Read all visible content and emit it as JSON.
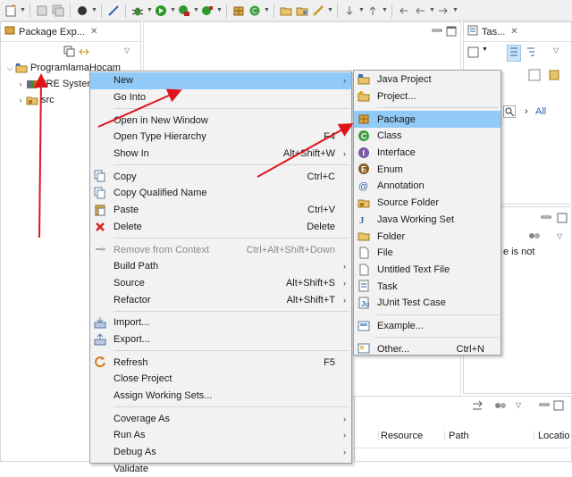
{
  "toolbar": {
    "icons": [
      "new-icon",
      "save-icon",
      "save-all-icon",
      "debug-skip-icon",
      "breakpoint-icon",
      "debug-icon",
      "run-icon",
      "coverage-icon",
      "external-tools-icon",
      "new-java-package-icon",
      "new-class-icon",
      "open-type-icon",
      "search-icon",
      "annotation-icon",
      "next-annotation-icon",
      "back-icon",
      "forward-icon"
    ]
  },
  "explorer": {
    "tab_title": "Package Exp...",
    "close": "✕",
    "tree": [
      {
        "label": "ProgramlamaHocam",
        "expanded": true
      },
      {
        "label": "JRE System",
        "expanded": false
      },
      {
        "label": "src",
        "expanded": false
      }
    ]
  },
  "task_view": {
    "tab_title": "Tas...",
    "find_placeholder": "",
    "all_label": "All",
    "outline_text": "e is not"
  },
  "problems_view": {
    "columns": [
      "Resource",
      "Path",
      "Locatio"
    ]
  },
  "context_menu": {
    "items": [
      {
        "label": "New",
        "shortcut": "",
        "sub": true,
        "icon": "",
        "highlighted": true
      },
      {
        "label": "Go Into",
        "shortcut": "",
        "sub": false,
        "icon": ""
      },
      {
        "sep": true
      },
      {
        "label": "Open in New Window",
        "shortcut": "",
        "sub": false,
        "icon": ""
      },
      {
        "label": "Open Type Hierarchy",
        "shortcut": "F4",
        "sub": false,
        "icon": ""
      },
      {
        "label": "Show In",
        "shortcut": "Alt+Shift+W",
        "sub": true,
        "icon": ""
      },
      {
        "sep": true
      },
      {
        "label": "Copy",
        "shortcut": "Ctrl+C",
        "sub": false,
        "icon": "copy-icon"
      },
      {
        "label": "Copy Qualified Name",
        "shortcut": "",
        "sub": false,
        "icon": "copy-icon"
      },
      {
        "label": "Paste",
        "shortcut": "Ctrl+V",
        "sub": false,
        "icon": "paste-icon"
      },
      {
        "label": "Delete",
        "shortcut": "Delete",
        "sub": false,
        "icon": "delete-icon"
      },
      {
        "sep": true
      },
      {
        "label": "Remove from Context",
        "shortcut": "Ctrl+Alt+Shift+Down",
        "sub": false,
        "icon": "remove-context-icon",
        "disabled": true
      },
      {
        "label": "Build Path",
        "shortcut": "",
        "sub": true,
        "icon": ""
      },
      {
        "label": "Source",
        "shortcut": "Alt+Shift+S",
        "sub": true,
        "icon": ""
      },
      {
        "label": "Refactor",
        "shortcut": "Alt+Shift+T",
        "sub": true,
        "icon": ""
      },
      {
        "sep": true
      },
      {
        "label": "Import...",
        "shortcut": "",
        "sub": false,
        "icon": "import-icon"
      },
      {
        "label": "Export...",
        "shortcut": "",
        "sub": false,
        "icon": "export-icon"
      },
      {
        "sep": true
      },
      {
        "label": "Refresh",
        "shortcut": "F5",
        "sub": false,
        "icon": "refresh-icon"
      },
      {
        "label": "Close Project",
        "shortcut": "",
        "sub": false,
        "icon": ""
      },
      {
        "label": "Assign Working Sets...",
        "shortcut": "",
        "sub": false,
        "icon": ""
      },
      {
        "sep": true
      },
      {
        "label": "Coverage As",
        "shortcut": "",
        "sub": true,
        "icon": ""
      },
      {
        "label": "Run As",
        "shortcut": "",
        "sub": true,
        "icon": ""
      },
      {
        "label": "Debug As",
        "shortcut": "",
        "sub": true,
        "icon": ""
      },
      {
        "label": "Validate",
        "shortcut": "",
        "sub": false,
        "icon": ""
      }
    ]
  },
  "submenu": {
    "items": [
      {
        "label": "Java Project",
        "shortcut": "",
        "icon": "java-project-icon"
      },
      {
        "label": "Project...",
        "shortcut": "",
        "icon": "project-icon"
      },
      {
        "sep": true
      },
      {
        "label": "Package",
        "shortcut": "",
        "icon": "package-icon",
        "highlighted": true
      },
      {
        "label": "Class",
        "shortcut": "",
        "icon": "class-icon"
      },
      {
        "label": "Interface",
        "shortcut": "",
        "icon": "interface-icon"
      },
      {
        "label": "Enum",
        "shortcut": "",
        "icon": "enum-icon"
      },
      {
        "label": "Annotation",
        "shortcut": "",
        "icon": "annotation-type-icon"
      },
      {
        "label": "Source Folder",
        "shortcut": "",
        "icon": "source-folder-icon"
      },
      {
        "label": "Java Working Set",
        "shortcut": "",
        "icon": "working-set-icon"
      },
      {
        "label": "Folder",
        "shortcut": "",
        "icon": "folder-icon"
      },
      {
        "label": "File",
        "shortcut": "",
        "icon": "file-icon"
      },
      {
        "label": "Untitled Text File",
        "shortcut": "",
        "icon": "text-file-icon"
      },
      {
        "label": "Task",
        "shortcut": "",
        "icon": "task-icon"
      },
      {
        "label": "JUnit Test Case",
        "shortcut": "",
        "icon": "junit-icon"
      },
      {
        "sep": true
      },
      {
        "label": "Example...",
        "shortcut": "",
        "icon": "example-icon"
      },
      {
        "sep": true
      },
      {
        "label": "Other...",
        "shortcut": "Ctrl+N",
        "icon": "other-icon"
      }
    ]
  },
  "colors": {
    "highlight": "#91c9f7",
    "arrow": "#e0141b",
    "menu_bg": "#f2f2f2"
  }
}
